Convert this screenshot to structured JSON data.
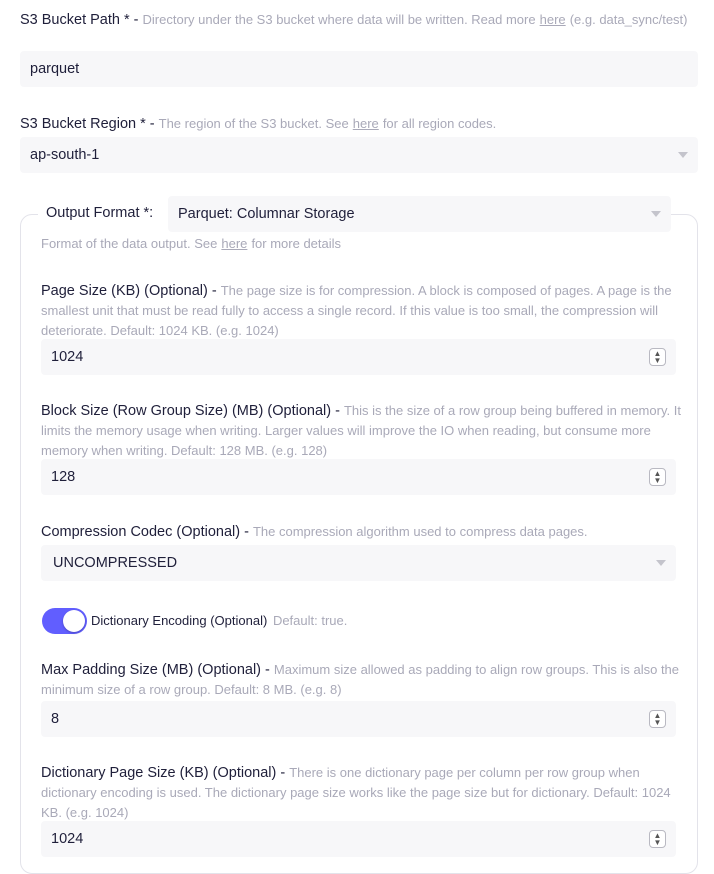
{
  "s3_path": {
    "label": "S3 Bucket Path * -",
    "desc_before": "Directory under the S3 bucket where data will be written. Read more",
    "link": "here",
    "desc_after": "(e.g. data_sync/test)",
    "value": "parquet"
  },
  "s3_region": {
    "label": "S3 Bucket Region * -",
    "desc_before": "The region of the S3 bucket. See",
    "link": "here",
    "desc_after": "for all region codes.",
    "value": "ap-south-1"
  },
  "output_format": {
    "label": "Output Format *:",
    "value": "Parquet: Columnar Storage",
    "desc_before": "Format of the data output. See",
    "link": "here",
    "desc_after": "for more details"
  },
  "page_size": {
    "label": "Page Size (KB) (Optional) -",
    "desc": "The page size is for compression. A block is composed of pages. A page is the smallest unit that must be read fully to access a single record. If this value is too small, the compression will deteriorate. Default: 1024 KB. (e.g. 1024)",
    "value": "1024"
  },
  "block_size": {
    "label": "Block Size (Row Group Size) (MB) (Optional) -",
    "desc": "This is the size of a row group being buffered in memory. It limits the memory usage when writing. Larger values will improve the IO when reading, but consume more memory when writing. Default: 128 MB. (e.g. 128)",
    "value": "128"
  },
  "compression": {
    "label": "Compression Codec (Optional) -",
    "desc": "The compression algorithm used to compress data pages.",
    "value": "UNCOMPRESSED"
  },
  "dictionary_encoding": {
    "label": "Dictionary Encoding (Optional)",
    "desc": "Default: true.",
    "on": true
  },
  "max_padding": {
    "label": "Max Padding Size (MB) (Optional) -",
    "desc": "Maximum size allowed as padding to align row groups. This is also the minimum size of a row group. Default: 8 MB. (e.g. 8)",
    "value": "8"
  },
  "dict_page_size": {
    "label": "Dictionary Page Size (KB) (Optional) -",
    "desc": "There is one dictionary page per column per row group when dictionary encoding is used. The dictionary page size works like the page size but for dictionary. Default: 1024 KB. (e.g. 1024)",
    "value": "1024"
  },
  "colors": {
    "accent": "#615eff",
    "input_bg": "#f7f7f9",
    "desc_text": "#a9a9b8"
  },
  "icons": {
    "select_caret": "chevron-down-icon",
    "number_spinner": "spinner-icon"
  }
}
